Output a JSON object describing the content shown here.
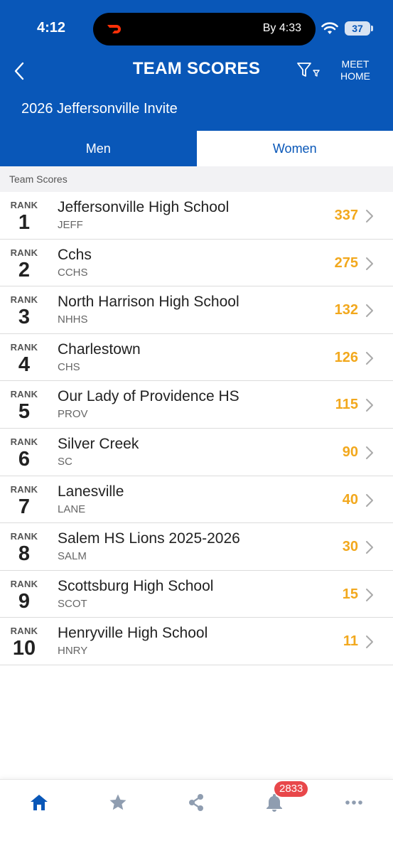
{
  "status_bar": {
    "time": "4:12",
    "activity_text": "By 4:33",
    "battery": "37"
  },
  "nav": {
    "title": "TEAM SCORES",
    "meet_home_line1": "MEET",
    "meet_home_line2": "HOME"
  },
  "meet_name": "2026 Jeffersonville Invite",
  "tabs": {
    "men": "Men",
    "women": "Women",
    "selected": "women"
  },
  "section_header": "Team Scores",
  "rank_label": "RANK",
  "teams": [
    {
      "rank": "1",
      "name": "Jeffersonville High School",
      "abbr": "JEFF",
      "score": "337"
    },
    {
      "rank": "2",
      "name": "Cchs",
      "abbr": "CCHS",
      "score": "275"
    },
    {
      "rank": "3",
      "name": "North Harrison High School",
      "abbr": "NHHS",
      "score": "132"
    },
    {
      "rank": "4",
      "name": "Charlestown",
      "abbr": "CHS",
      "score": "126"
    },
    {
      "rank": "5",
      "name": "Our Lady of Providence HS",
      "abbr": "PROV",
      "score": "115"
    },
    {
      "rank": "6",
      "name": "Silver Creek",
      "abbr": "SC",
      "score": "90"
    },
    {
      "rank": "7",
      "name": "Lanesville",
      "abbr": "LANE",
      "score": "40"
    },
    {
      "rank": "8",
      "name": "Salem HS Lions 2025-2026",
      "abbr": "SALM",
      "score": "30"
    },
    {
      "rank": "9",
      "name": "Scottsburg High School",
      "abbr": "SCOT",
      "score": "15"
    },
    {
      "rank": "10",
      "name": "Henryville High School",
      "abbr": "HNRY",
      "score": "11"
    }
  ],
  "bottom_bar": {
    "notification_count": "2833"
  },
  "colors": {
    "brand_blue": "#0957b8",
    "score_gold": "#f2a81d",
    "badge_red": "#e8474a",
    "inactive_icon": "#8f9db0"
  },
  "icons": [
    "back-icon",
    "filter-icon",
    "home-icon",
    "star-icon",
    "share-icon",
    "bell-icon",
    "more-icon",
    "chevron-right-icon",
    "wifi-icon"
  ]
}
